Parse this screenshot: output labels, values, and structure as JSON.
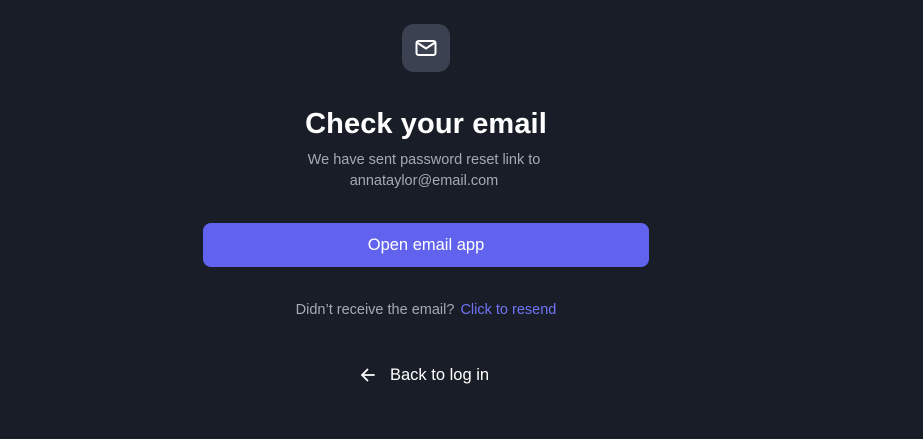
{
  "header": {
    "icon": "mail-icon",
    "title": "Check your email",
    "subtitle_line1": "We have sent password reset link to",
    "email": "annataylor@email.com"
  },
  "actions": {
    "open_email_label": "Open email app",
    "resend_prompt": "Didn’t receive the email?",
    "resend_link": "Click to resend",
    "back_icon": "arrow-left-icon",
    "back_label": "Back to log in"
  },
  "colors": {
    "background": "#181d27",
    "icon_tile": "#3b4150",
    "primary": "#6163ee",
    "link": "#7073f5",
    "muted_text": "#a4a9b5"
  }
}
